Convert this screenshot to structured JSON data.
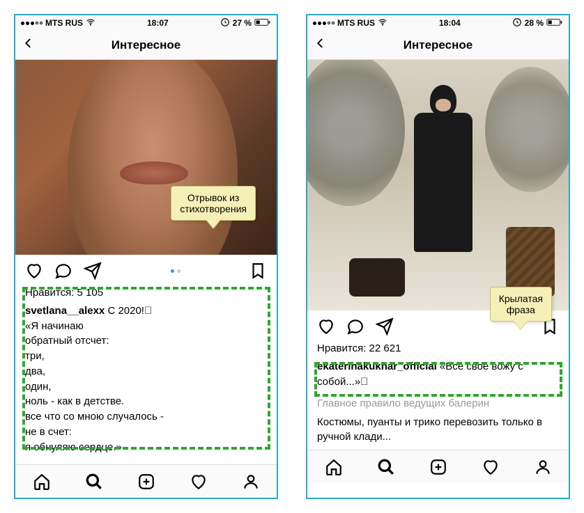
{
  "left": {
    "status": {
      "carrier": "MTS RUS",
      "time": "18:07",
      "batteryText": "27 %"
    },
    "header": {
      "title": "Интересное"
    },
    "callout": "Отрывок из\nстихотворения",
    "likesLabel": "Нравится:",
    "likesCount": "5 105",
    "username": "svetlana__alexx",
    "captionLead": "С 2020!⃞",
    "caption": "«Я начинаю\nобратный отсчет:\nтри,\nдва,\nодин,\nноль - как в детстве.\nвсе что со мною случалось -\nне в счет:\nя обнуляю сердце.»"
  },
  "right": {
    "status": {
      "carrier": "MTS RUS",
      "time": "18:04",
      "batteryText": "28 %"
    },
    "header": {
      "title": "Интересное"
    },
    "callout": "Крылатая\nфраза",
    "likesLabel": "Нравится:",
    "likesCount": "22 621",
    "username": "ekaterinakukhar_official",
    "captionLead": "«Все своё вожу с собой...»⃞",
    "mutedLine": "Главное правило ведущих балерин",
    "sub": "Костюмы, пуанты и трико перевозить только в ручной клади..."
  }
}
